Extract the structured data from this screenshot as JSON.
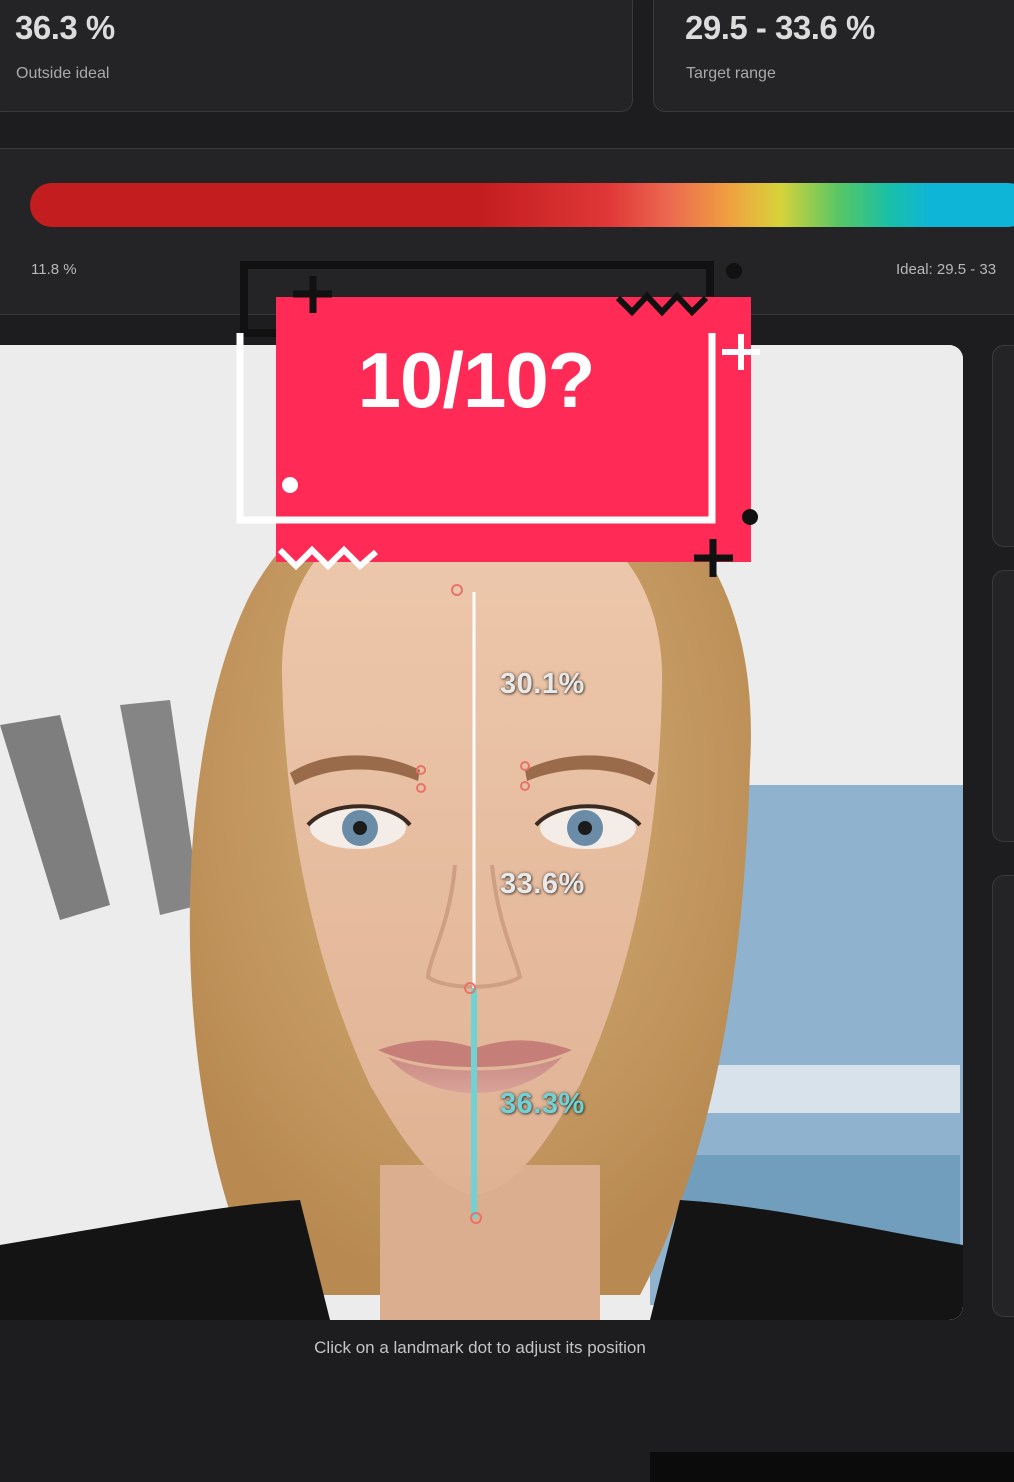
{
  "stats": [
    {
      "value": "36.3 %",
      "label": "Outside ideal"
    },
    {
      "value": "29.5 - 33.6 %",
      "label": "Target range"
    }
  ],
  "spectrum": {
    "min_label": "11.8 %",
    "ideal_label": "Ideal: 29.5 - 33"
  },
  "measurements": [
    {
      "value": "30.1%",
      "color": "#e9e9e9"
    },
    {
      "value": "33.6%",
      "color": "#e9e9e9"
    },
    {
      "value": "36.3%",
      "color": "#6fd3d6"
    }
  ],
  "overlay": {
    "text": "10/10?",
    "accent": "#ff2a55"
  },
  "hint": "Click on a landmark dot to adjust its position",
  "colors": {
    "background": "#1d1d1f",
    "panel": "#242426",
    "line": "#ffffff",
    "line_lower": "#6fd3d6",
    "landmark": "#e8736b"
  }
}
